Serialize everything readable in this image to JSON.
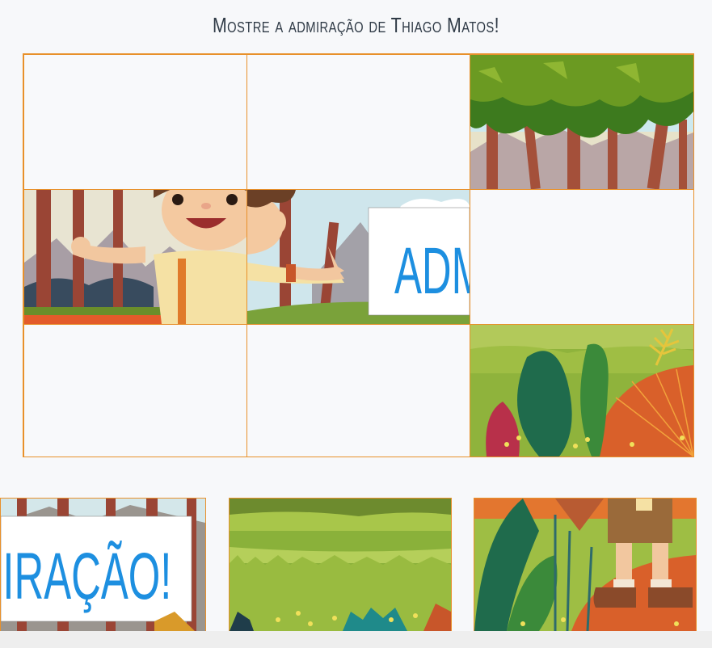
{
  "game": {
    "title": "Mostre a admiração de Thiago Matos!",
    "banner_text": "ADMIRAÇÃO!",
    "banner_fragment_board": "ADM",
    "banner_fragment_tray": "MIRAÇÃO!"
  },
  "board": {
    "rows": 3,
    "cols": 3,
    "cells": [
      {
        "row": 1,
        "col": 1,
        "filled": false
      },
      {
        "row": 1,
        "col": 2,
        "filled": false
      },
      {
        "row": 1,
        "col": 3,
        "filled": true,
        "piece": "treetops"
      },
      {
        "row": 2,
        "col": 1,
        "filled": true,
        "piece": "boy-left"
      },
      {
        "row": 2,
        "col": 2,
        "filled": true,
        "piece": "boy-right-banner"
      },
      {
        "row": 2,
        "col": 3,
        "filled": false
      },
      {
        "row": 3,
        "col": 1,
        "filled": false
      },
      {
        "row": 3,
        "col": 2,
        "filled": false
      },
      {
        "row": 3,
        "col": 3,
        "filled": true,
        "piece": "plants"
      }
    ]
  },
  "tray": {
    "pieces": [
      "banner-end",
      "grass-field",
      "boy-legs"
    ]
  },
  "colors": {
    "accent": "#e8902a",
    "banner_text": "#1d8fe0",
    "title_text": "#2f3a46",
    "background": "#f7f8fa"
  }
}
